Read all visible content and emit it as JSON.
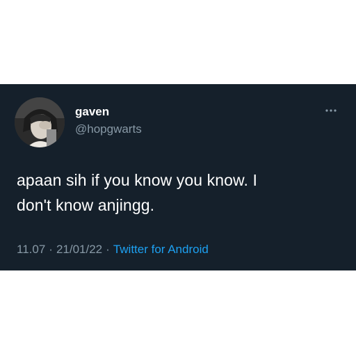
{
  "tweet": {
    "author": {
      "display_name": "gaven",
      "handle": "@hopgwarts",
      "avatar_icon": "profile-photo"
    },
    "more_icon": "more-horizontal-icon",
    "text_line1": "apaan sih if you know you know. I",
    "text_line2": "don't know anjingg.",
    "time": "11.07",
    "date": "21/01/22",
    "separator": "·",
    "source": "Twitter for Android"
  },
  "colors": {
    "background": "#15202b",
    "primary_text": "#ffffff",
    "secondary_text": "#8899a6",
    "link": "#1da1f2"
  }
}
